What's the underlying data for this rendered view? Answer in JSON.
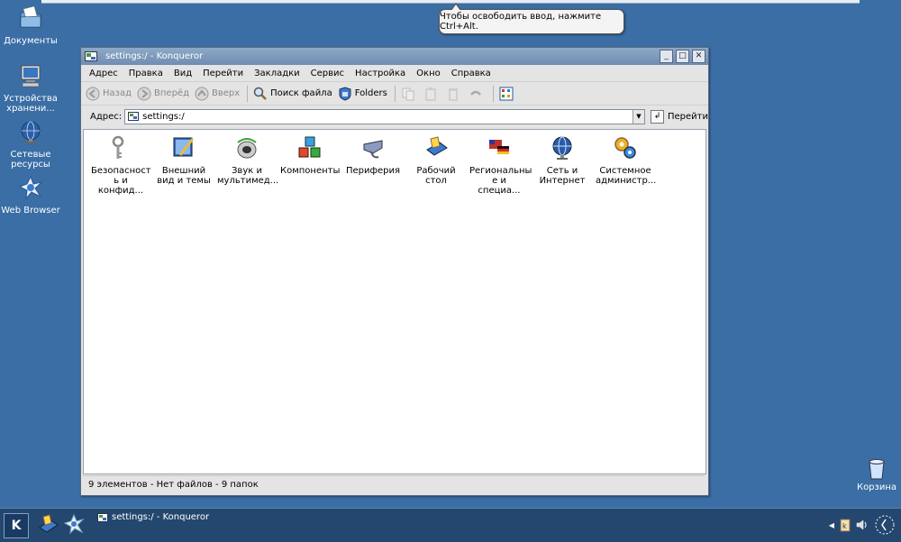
{
  "desktop": {
    "icons": [
      {
        "label": "Документы",
        "icon": "documents-folder-icon"
      },
      {
        "label": "Устройства хранени...",
        "icon": "storage-devices-icon"
      },
      {
        "label": "Сетевые ресурсы",
        "icon": "network-resources-icon"
      },
      {
        "label": "Web Browser",
        "icon": "web-browser-icon"
      }
    ],
    "trash_label": "Корзина"
  },
  "tooltip": {
    "text": "Чтобы освободить ввод, нажмите Ctrl+Alt."
  },
  "window": {
    "title": "settings:/ - Konqueror",
    "menu": [
      "Адрес",
      "Правка",
      "Вид",
      "Перейти",
      "Закладки",
      "Сервис",
      "Настройка",
      "Окно",
      "Справка"
    ],
    "toolbar": {
      "back": "Назад",
      "forward": "Вперёд",
      "up": "Вверх",
      "find": "Поиск файла",
      "folders": "Folders"
    },
    "address": {
      "label": "Адрес:",
      "value": "settings:/",
      "go": "Перейти"
    },
    "items": [
      {
        "label": "Безопасност ь и конфид...",
        "icon": "keys-icon"
      },
      {
        "label": "Внешний вид и темы",
        "icon": "appearance-icon"
      },
      {
        "label": "Звук и мультимед...",
        "icon": "speaker-icon"
      },
      {
        "label": "Компоненты",
        "icon": "components-icon"
      },
      {
        "label": "Периферия",
        "icon": "peripherals-icon"
      },
      {
        "label": "Рабочий стол",
        "icon": "desktop-icon"
      },
      {
        "label": "Региональны е и специа...",
        "icon": "flags-icon"
      },
      {
        "label": "Сеть и Интернет",
        "icon": "globe-icon"
      },
      {
        "label": "Системное администр...",
        "icon": "gears-icon"
      }
    ],
    "status": "9 элементов - Нет файлов - 9 папок"
  },
  "taskbar": {
    "task_title": "settings:/ - Konqueror"
  },
  "colors": {
    "desktop": "#3a6ea5",
    "taskbar": "#24476f",
    "titlebar": "#7f9bbd"
  }
}
